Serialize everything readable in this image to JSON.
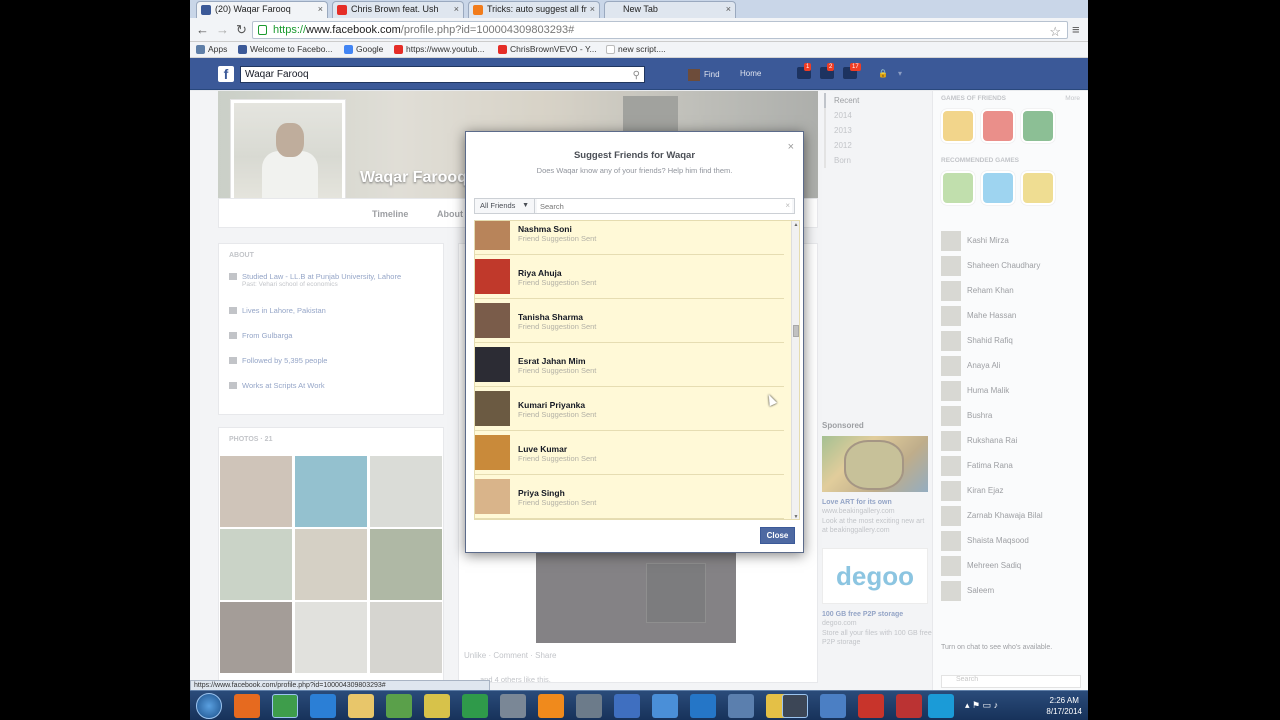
{
  "browser": {
    "tabs": [
      {
        "label": "(20) Waqar Farooq",
        "color": "#3b5998"
      },
      {
        "label": "Chris Brown feat. Ush",
        "color": "#e52d27"
      },
      {
        "label": "Tricks: auto suggest all fr",
        "color": "#f27c1c"
      },
      {
        "label": "New Tab",
        "color": "#dfe6ef"
      }
    ],
    "url_https": "https://",
    "url_host": "www.facebook.com",
    "url_path": "/profile.php?id=100004309803293#",
    "bookmarks": [
      {
        "label": "Apps",
        "color": "#5f7fa8"
      },
      {
        "label": "Welcome to Facebo...",
        "color": "#3b5998"
      },
      {
        "label": "Google",
        "color": "#4285f4"
      },
      {
        "label": "https://www.youtub...",
        "color": "#e52d27"
      },
      {
        "label": "ChrisBrownVEVO - Y...",
        "color": "#e52d27"
      },
      {
        "label": "new script....",
        "color": "#bbbbbb"
      }
    ],
    "status_url": "https://www.facebook.com/profile.php?id=100004309803293#"
  },
  "fb": {
    "logo": "f",
    "search_value": "Waqar Farooq",
    "nav_find": "Find",
    "nav_home": "Home",
    "jewel_counts": [
      "1",
      "2",
      "17"
    ]
  },
  "profile": {
    "name": "Waqar Farooq",
    "tabs": [
      "Timeline",
      "About"
    ],
    "about_header": "ABOUT",
    "about_rows": [
      {
        "text": "Studied Law - LL.B at Punjab University, Lahore",
        "sub": "Past: Vehari school of economics"
      },
      {
        "text": "Lives in Lahore, Pakistan",
        "sub": ""
      },
      {
        "text": "From Gulbarga",
        "sub": ""
      },
      {
        "text": "Followed by 5,395 people",
        "sub": ""
      },
      {
        "text": "Works at Scripts At Work",
        "sub": ""
      }
    ],
    "photos_header": "PHOTOS",
    "photos_count": "21",
    "years": [
      "Recent",
      "2014",
      "2013",
      "2012",
      "Born"
    ],
    "post_actions": "Unlike · Comment · Share",
    "post_likes": "and 4 others like this."
  },
  "right_col": {
    "games_header": "GAMES OF FRIENDS",
    "games_see": "More",
    "recommended_header": "RECOMMENDED GAMES",
    "chat": [
      "Kashi Mirza",
      "Shaheen Chaudhary",
      "Reham Khan",
      "Mahe Hassan",
      "Shahid Rafiq",
      "Anaya Ali",
      "Huma Malik",
      "Bushra",
      "Rukshana Rai",
      "Fatima Rana",
      "Kiran Ejaz",
      "Zarnab Khawaja Bilal",
      "Shaista Maqsood",
      "Mehreen Sadiq",
      "Saleem"
    ],
    "chat_footer": "Turn on chat to see who's available.",
    "chat_search": "Search"
  },
  "sponsored": {
    "title": "Sponsored",
    "ad1_title": "Love ART for its own",
    "ad1_url": "www.beakingallery.com",
    "ad1_body": "Look at the most exciting new art at beakinggallery.com",
    "ad2_brand": "degoo",
    "ad2_title": "100 GB free P2P storage",
    "ad2_url": "degoo.com",
    "ad2_body": "Store all your files with 100 GB free P2P storage"
  },
  "modal": {
    "title": "Suggest Friends for Waqar",
    "subtitle": "Does Waqar know any of your friends? Help him find them.",
    "filter_label": "All Friends",
    "search_placeholder": "Search",
    "close_label": "Close",
    "friends": [
      {
        "name": "Nashma Soni",
        "status": "Friend Suggestion Sent",
        "color": "#b8845a"
      },
      {
        "name": "Riya Ahuja",
        "status": "Friend Suggestion Sent",
        "color": "#c0392b"
      },
      {
        "name": "Tanisha Sharma",
        "status": "Friend Suggestion Sent",
        "color": "#7a5c4a"
      },
      {
        "name": "Esrat Jahan Mim",
        "status": "Friend Suggestion Sent",
        "color": "#2c2c34"
      },
      {
        "name": "Kumari Priyanka",
        "status": "Friend Suggestion Sent",
        "color": "#6b5a42"
      },
      {
        "name": "Luve Kumar",
        "status": "Friend Suggestion Sent",
        "color": "#c98a3a"
      },
      {
        "name": "Priya Singh",
        "status": "Friend Suggestion Sent",
        "color": "#d9b48a"
      },
      {
        "name": "",
        "status": "",
        "color": "#555555"
      }
    ]
  },
  "taskbar": {
    "time": "2:26 AM",
    "date": "8/17/2014"
  }
}
